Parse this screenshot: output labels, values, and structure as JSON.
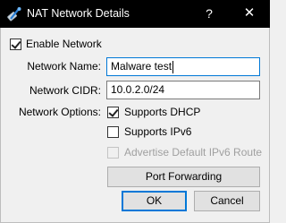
{
  "window": {
    "title": "NAT Network Details",
    "help_glyph": "?",
    "close_glyph": "✕"
  },
  "enable": {
    "label": "Enable Network",
    "checked": true
  },
  "network_name": {
    "label": "Network Name:",
    "value": "Malware test"
  },
  "network_cidr": {
    "label": "Network CIDR:",
    "value": "10.0.2.0/24"
  },
  "network_options": {
    "label": "Network Options:",
    "supports_dhcp": {
      "label": "Supports DHCP",
      "checked": true
    },
    "supports_ipv6": {
      "label": "Supports IPv6",
      "checked": false
    },
    "advertise_ipv6": {
      "label": "Advertise Default IPv6 Route",
      "checked": false,
      "enabled": false
    }
  },
  "buttons": {
    "port_forwarding": "Port Forwarding",
    "ok": "OK",
    "cancel": "Cancel"
  },
  "colors": {
    "titlebar": "#000000",
    "focus": "#0078d7",
    "dialog_bg": "#f0f0f0"
  }
}
